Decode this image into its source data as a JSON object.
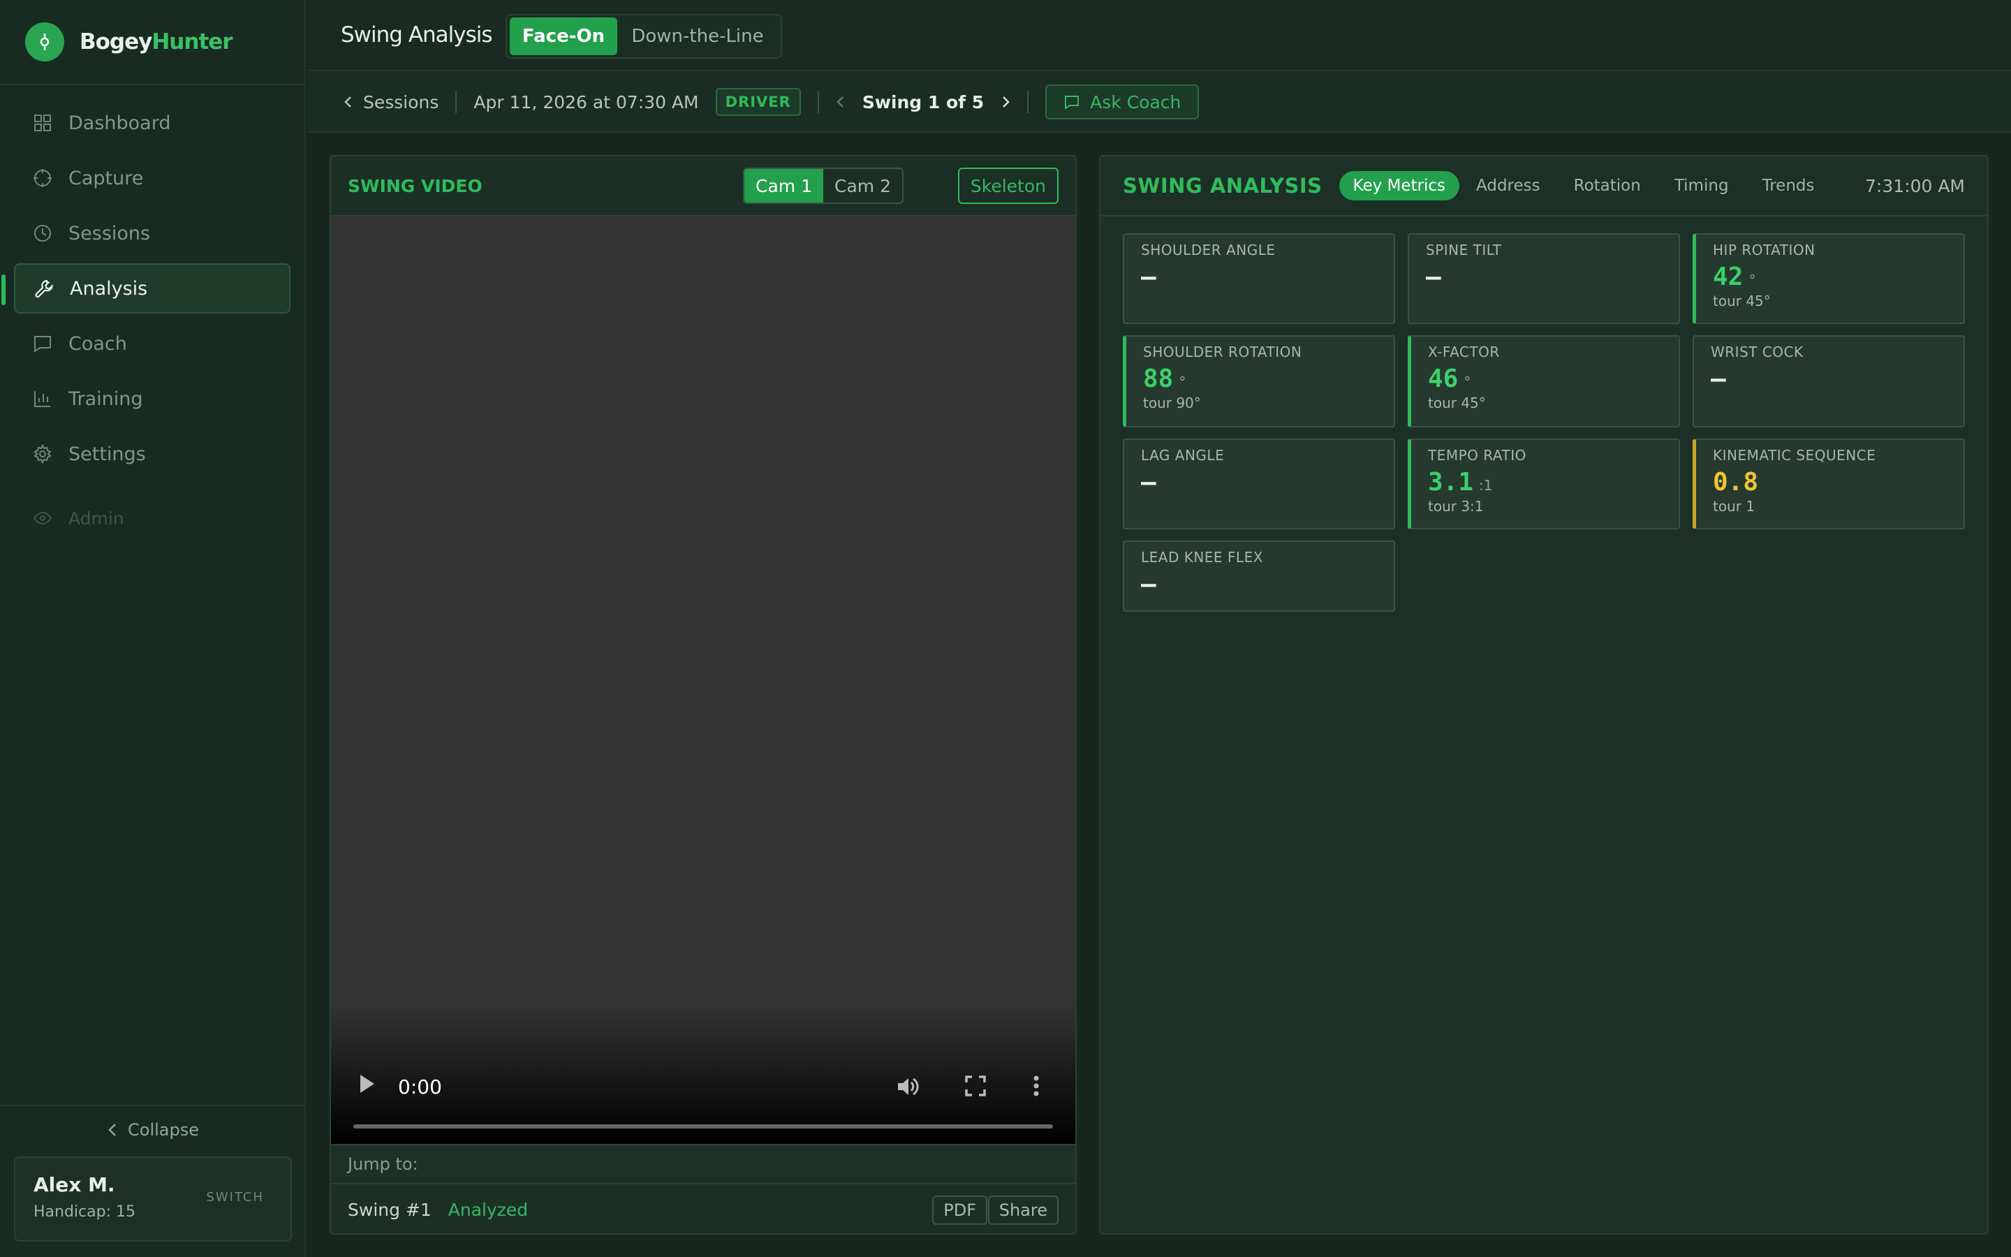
{
  "brand": {
    "part1": "Bogey",
    "part2": "Hunter"
  },
  "sidebar": {
    "items": [
      {
        "label": "Dashboard",
        "icon": "grid-icon"
      },
      {
        "label": "Capture",
        "icon": "crosshair-icon"
      },
      {
        "label": "Sessions",
        "icon": "clock-icon"
      },
      {
        "label": "Analysis",
        "icon": "wrench-icon",
        "active": true
      },
      {
        "label": "Coach",
        "icon": "chat-icon"
      },
      {
        "label": "Training",
        "icon": "bar-chart-icon"
      },
      {
        "label": "Settings",
        "icon": "gear-icon"
      }
    ],
    "admin_label": "Admin",
    "collapse_label": "Collapse"
  },
  "user": {
    "name": "Alex M.",
    "handicap": "Handicap: 15",
    "switch_label": "SWITCH"
  },
  "header": {
    "title": "Swing Analysis",
    "views": [
      "Face-On",
      "Down-the-Line"
    ]
  },
  "subbar": {
    "back_label": "Sessions",
    "date": "Apr 11, 2026 at 07:30 AM",
    "club_badge": "DRIVER",
    "swing_counter": "Swing 1 of 5",
    "coach_label": "Ask Coach"
  },
  "video": {
    "title": "SWING VIDEO",
    "cams": [
      "Cam 1",
      "Cam 2"
    ],
    "skeleton_label": "Skeleton",
    "time": "0:00",
    "jump_label": "Jump to:",
    "swing_id": "Swing #1",
    "status": "Analyzed",
    "pdf_label": "PDF",
    "share_label": "Share"
  },
  "analysis": {
    "title": "SWING ANALYSIS",
    "tabs": [
      "Key Metrics",
      "Address",
      "Rotation",
      "Timing",
      "Trends"
    ],
    "time": "7:31:00 AM",
    "metrics": [
      {
        "label": "SHOULDER ANGLE",
        "value": "—",
        "unit": "",
        "ref": ""
      },
      {
        "label": "SPINE TILT",
        "value": "—",
        "unit": "",
        "ref": ""
      },
      {
        "label": "HIP ROTATION",
        "value": "42",
        "unit": "°",
        "ref": "tour 45°"
      },
      {
        "label": "SHOULDER ROTATION",
        "value": "88",
        "unit": "°",
        "ref": "tour 90°"
      },
      {
        "label": "X-FACTOR",
        "value": "46",
        "unit": "°",
        "ref": "tour 45°"
      },
      {
        "label": "WRIST COCK",
        "value": "—",
        "unit": "",
        "ref": ""
      },
      {
        "label": "LAG ANGLE",
        "value": "—",
        "unit": "",
        "ref": ""
      },
      {
        "label": "TEMPO RATIO",
        "value": "3.1",
        "unit": ":1",
        "ref": "tour 3:1"
      },
      {
        "label": "KINEMATIC SEQUENCE",
        "value": "0.8",
        "unit": "",
        "ref": "tour 1"
      },
      {
        "label": "LEAD KNEE FLEX",
        "value": "—",
        "unit": "",
        "ref": ""
      }
    ]
  },
  "colors": {
    "accent": "#2fbb5c",
    "warning": "#f0c530",
    "background": "#17271f"
  }
}
